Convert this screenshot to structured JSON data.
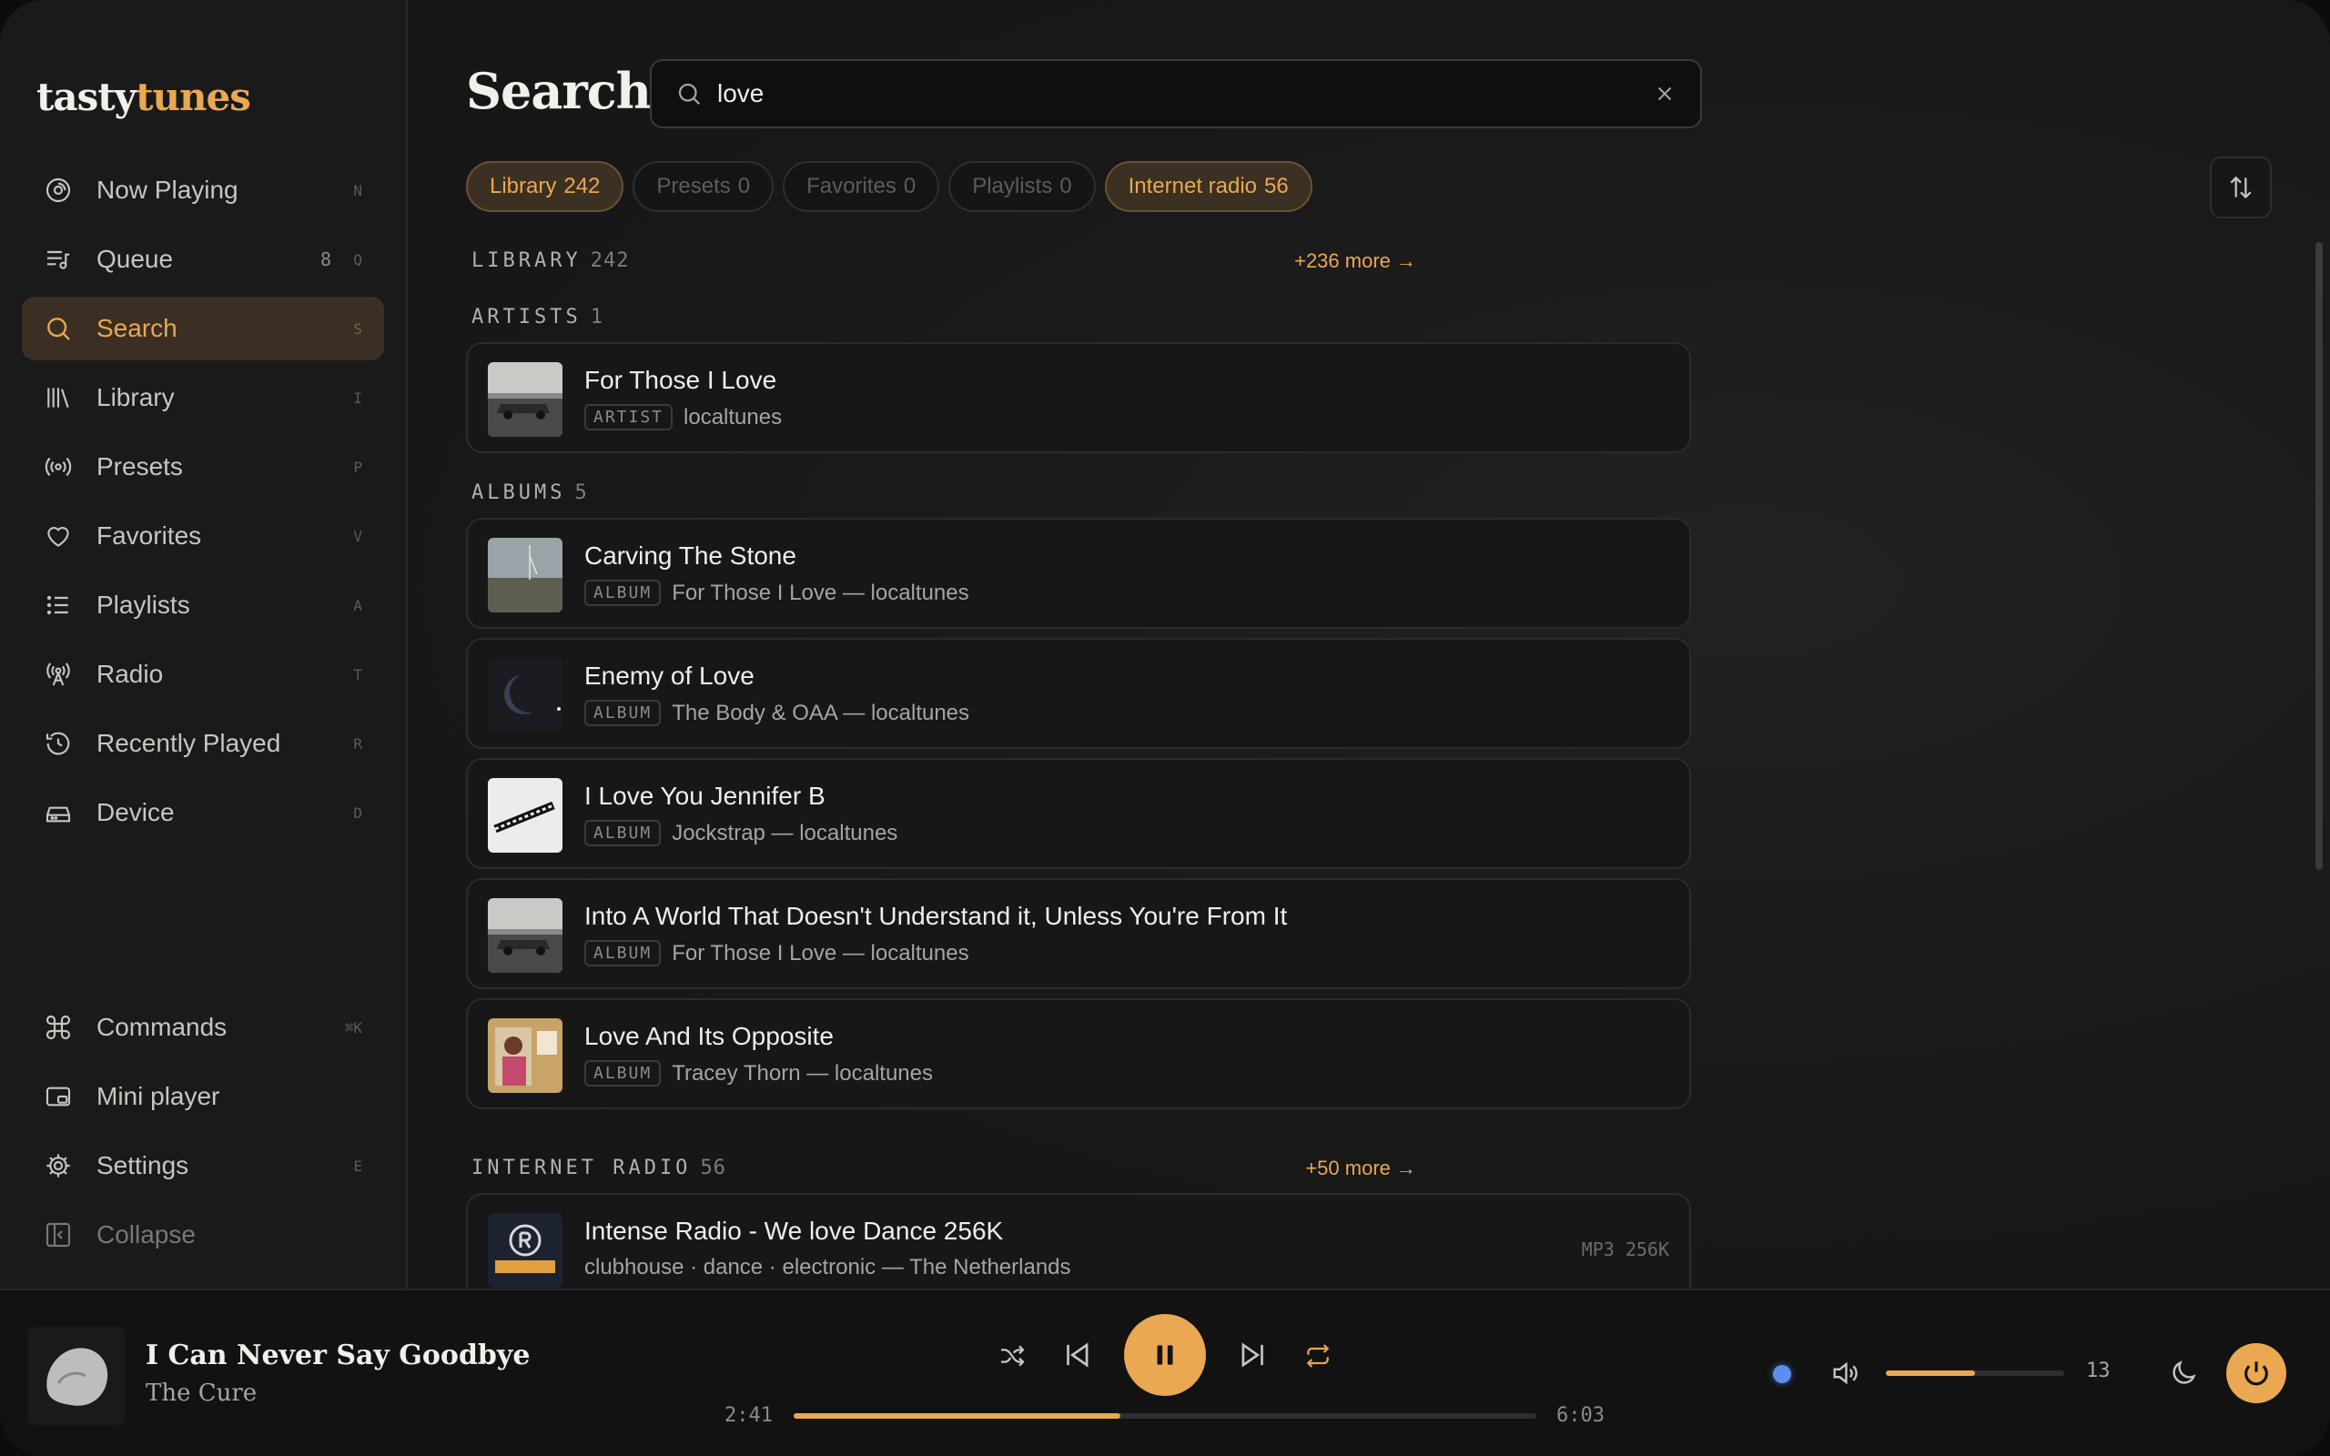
{
  "app": {
    "logo_part1": "tasty",
    "logo_part2": "tunes",
    "accent": "#e9a851"
  },
  "sidebar": {
    "items": [
      {
        "label": "Now Playing",
        "key": "N",
        "icon": "disc-icon"
      },
      {
        "label": "Queue",
        "count": "8",
        "key": "Q",
        "icon": "queue-icon"
      },
      {
        "label": "Search",
        "key": "S",
        "icon": "search-icon",
        "active": true
      },
      {
        "label": "Library",
        "key": "I",
        "icon": "library-icon"
      },
      {
        "label": "Presets",
        "key": "P",
        "icon": "broadcast-icon"
      },
      {
        "label": "Favorites",
        "key": "V",
        "icon": "heart-icon"
      },
      {
        "label": "Playlists",
        "key": "A",
        "icon": "list-icon"
      },
      {
        "label": "Radio",
        "key": "T",
        "icon": "radio-tower-icon"
      },
      {
        "label": "Recently Played",
        "key": "R",
        "icon": "history-icon"
      },
      {
        "label": "Device",
        "key": "D",
        "icon": "device-icon"
      }
    ],
    "bottom": [
      {
        "label": "Commands",
        "key": "⌘K",
        "icon": "command-icon"
      },
      {
        "label": "Mini player",
        "icon": "mini-player-icon"
      },
      {
        "label": "Settings",
        "key": "E",
        "icon": "gear-icon"
      },
      {
        "label": "Collapse",
        "icon": "collapse-icon"
      }
    ]
  },
  "search": {
    "title": "Search",
    "query": "love",
    "filters": [
      {
        "label": "Library",
        "count": "242",
        "active": true
      },
      {
        "label": "Presets",
        "count": "0"
      },
      {
        "label": "Favorites",
        "count": "0"
      },
      {
        "label": "Playlists",
        "count": "0"
      },
      {
        "label": "Internet radio",
        "count": "56",
        "active": true
      }
    ]
  },
  "results": {
    "library": {
      "label": "LIBRARY",
      "count": "242",
      "more": "+236 more →"
    },
    "artists": {
      "label": "ARTISTS",
      "count": "1",
      "items": [
        {
          "title": "For Those I Love",
          "tag": "ARTIST",
          "meta": "localtunes"
        }
      ]
    },
    "albums": {
      "label": "ALBUMS",
      "count": "5",
      "items": [
        {
          "title": "Carving The Stone",
          "tag": "ALBUM",
          "meta": "For Those I Love — localtunes"
        },
        {
          "title": "Enemy of Love",
          "tag": "ALBUM",
          "meta": "The Body & OAA — localtunes"
        },
        {
          "title": "I Love You Jennifer B",
          "tag": "ALBUM",
          "meta": "Jockstrap — localtunes"
        },
        {
          "title": "Into A World That Doesn't Understand it, Unless You're From It",
          "tag": "ALBUM",
          "meta": "For Those I Love — localtunes"
        },
        {
          "title": "Love And Its Opposite",
          "tag": "ALBUM",
          "meta": "Tracey Thorn — localtunes"
        }
      ]
    },
    "radio": {
      "label": "INTERNET RADIO",
      "count": "56",
      "more": "+50 more →",
      "items": [
        {
          "title": "Intense Radio - We love Dance 256K",
          "meta": "clubhouse · dance · electronic — The Netherlands",
          "format": "MP3 256K"
        }
      ]
    }
  },
  "player": {
    "title": "I Can Never Say Goodbye",
    "artist": "The Cure",
    "elapsed": "2:41",
    "duration": "6:03",
    "progress": 0.44,
    "volume": "13",
    "volume_level": 0.5,
    "icons": [
      "shuffle-icon",
      "previous-icon",
      "pause-icon",
      "next-icon",
      "repeat-icon",
      "speaker-icon",
      "moon-icon",
      "power-icon"
    ]
  }
}
